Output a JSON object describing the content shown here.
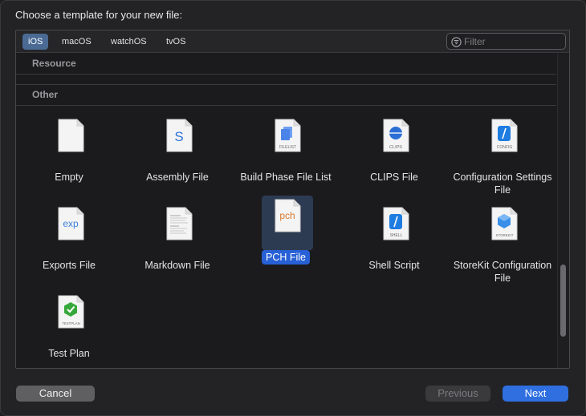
{
  "dialog": {
    "title": "Choose a template for your new file:"
  },
  "platform_tabs": [
    {
      "label": "iOS",
      "selected": true
    },
    {
      "label": "macOS",
      "selected": false
    },
    {
      "label": "watchOS",
      "selected": false
    },
    {
      "label": "tvOS",
      "selected": false
    }
  ],
  "filter": {
    "placeholder": "Filter",
    "value": ""
  },
  "sections": {
    "resource": "Resource",
    "other": "Other"
  },
  "templates": [
    {
      "label": "Empty",
      "icon": "empty-file-icon"
    },
    {
      "label": "Assembly File",
      "icon": "assembly-file-icon",
      "glyph": "S"
    },
    {
      "label": "Build Phase File List",
      "icon": "filelist-icon",
      "glyph": "FILELIST"
    },
    {
      "label": "CLIPS File",
      "icon": "clips-file-icon",
      "glyph": "CLIPS"
    },
    {
      "label": "Configuration Settings File",
      "icon": "config-file-icon",
      "glyph": "CONFIG"
    },
    {
      "label": "Exports File",
      "icon": "exports-file-icon",
      "glyph": "exp"
    },
    {
      "label": "Markdown File",
      "icon": "markdown-file-icon"
    },
    {
      "label": "PCH File",
      "icon": "pch-file-icon",
      "glyph": "pch",
      "selected": true
    },
    {
      "label": "Shell Script",
      "icon": "shell-script-icon",
      "glyph": "SHELL"
    },
    {
      "label": "StoreKit Configuration File",
      "icon": "storekit-file-icon",
      "glyph": "STOREKIT"
    },
    {
      "label": "Test Plan",
      "icon": "test-plan-icon",
      "glyph": "TESTPLAN"
    }
  ],
  "buttons": {
    "cancel": "Cancel",
    "previous": "Previous",
    "next": "Next"
  },
  "colors": {
    "accent": "#2f6fe0",
    "selection": "#2860d6",
    "swift_blue": "#1f7ce0",
    "pch_orange": "#d8782c",
    "check_green": "#36a83a"
  }
}
